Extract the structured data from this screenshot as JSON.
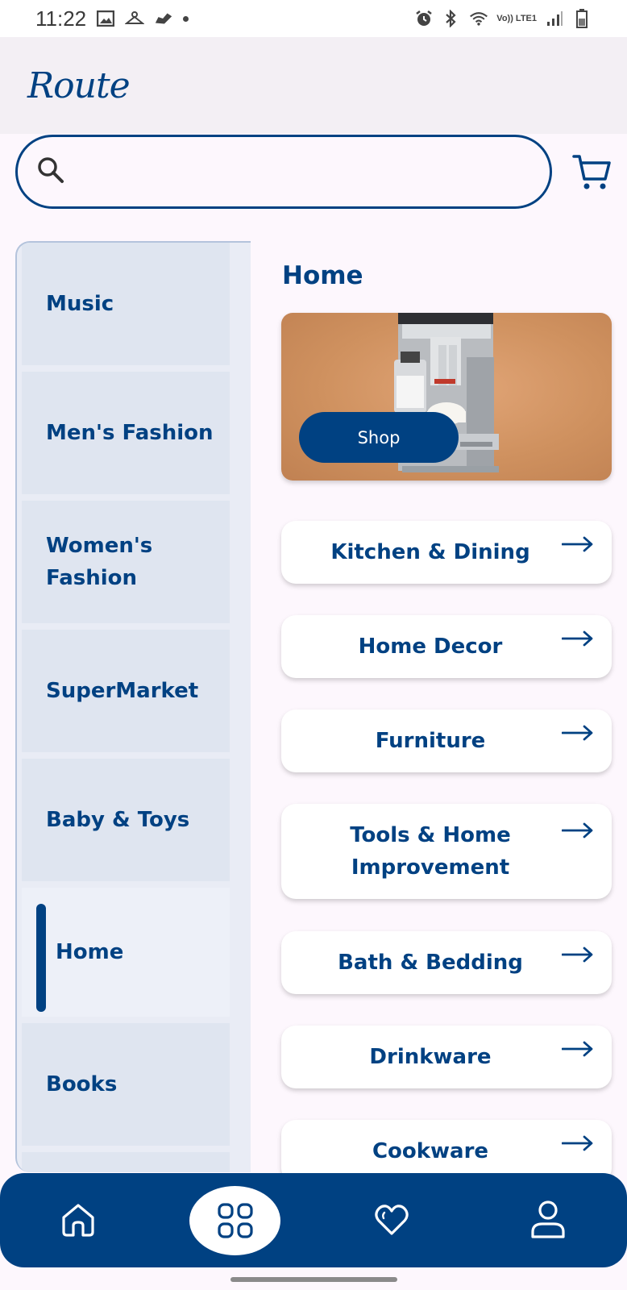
{
  "status_bar": {
    "time": "11:22",
    "network_label": "Vo)) LTE1",
    "icons": [
      "image-icon",
      "hanger-icon",
      "shoe-icon",
      "dot-icon",
      "alarm-icon",
      "bluetooth-icon",
      "wifi-icon",
      "signal-icon",
      "battery-icon"
    ]
  },
  "header": {
    "logo_text": "Route"
  },
  "search": {
    "value": "",
    "placeholder": "",
    "icon": "search-icon"
  },
  "cart": {
    "icon": "cart-icon"
  },
  "sidebar": {
    "items": [
      {
        "label": "Music",
        "selected": false
      },
      {
        "label": "Men's Fashion",
        "selected": false
      },
      {
        "label": "Women's Fashion",
        "selected": false
      },
      {
        "label": "SuperMarket",
        "selected": false
      },
      {
        "label": "Baby & Toys",
        "selected": false
      },
      {
        "label": "Home",
        "selected": true
      },
      {
        "label": "Books",
        "selected": false
      }
    ]
  },
  "main": {
    "title": "Home",
    "banner": {
      "button_label": "Shop"
    },
    "subcategories": [
      {
        "label": "Kitchen & Dining"
      },
      {
        "label": "Home Decor"
      },
      {
        "label": "Furniture"
      },
      {
        "label": "Tools & Home Improvement"
      },
      {
        "label": "Bath & Bedding"
      },
      {
        "label": "Drinkware"
      },
      {
        "label": "Cookware"
      }
    ]
  },
  "bottom_nav": {
    "items": [
      {
        "icon": "home-icon",
        "active": false
      },
      {
        "icon": "categories-grid-icon",
        "active": true
      },
      {
        "icon": "heart-icon",
        "active": false
      },
      {
        "icon": "profile-icon",
        "active": false
      }
    ]
  },
  "colors": {
    "primary": "#004182",
    "background": "#fdf7fd",
    "header_bg": "#f3eff4",
    "sidebar_bg": "#dfe5f0",
    "card_bg": "#ffffff"
  }
}
